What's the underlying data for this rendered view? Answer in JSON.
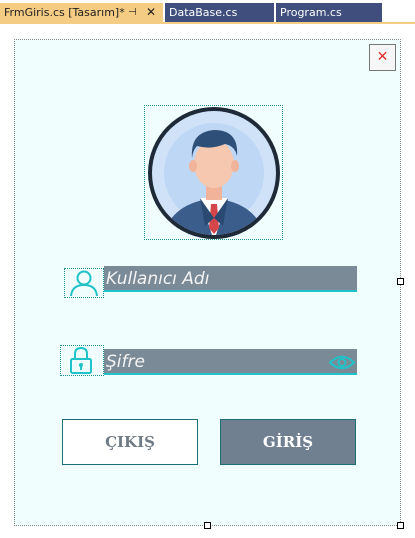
{
  "tabs": [
    {
      "label": "FrmGiris.cs [Tasarım]*",
      "active": true
    },
    {
      "label": "DataBase.cs",
      "active": false
    },
    {
      "label": "Program.cs",
      "active": false
    }
  ],
  "tab_pin_glyph": "⊣",
  "tab_close_glyph": "✕",
  "form": {
    "close_glyph": "✕",
    "username_placeholder": "Kullanıcı Adı",
    "password_placeholder": "Şifre",
    "exit_label": "ÇIKIŞ",
    "login_label": "GİRİŞ"
  },
  "icons": {
    "avatar": "businessman-avatar-icon",
    "user": "user-icon",
    "lock": "lock-icon",
    "eye": "eye-icon"
  },
  "colors": {
    "form_bg": "#f0fffe",
    "field_bg": "#7a8a97",
    "accent": "#20c3c9",
    "active_tab": "#f5cc84",
    "inactive_tab": "#3f4e7d",
    "close_red": "#e0312d"
  }
}
